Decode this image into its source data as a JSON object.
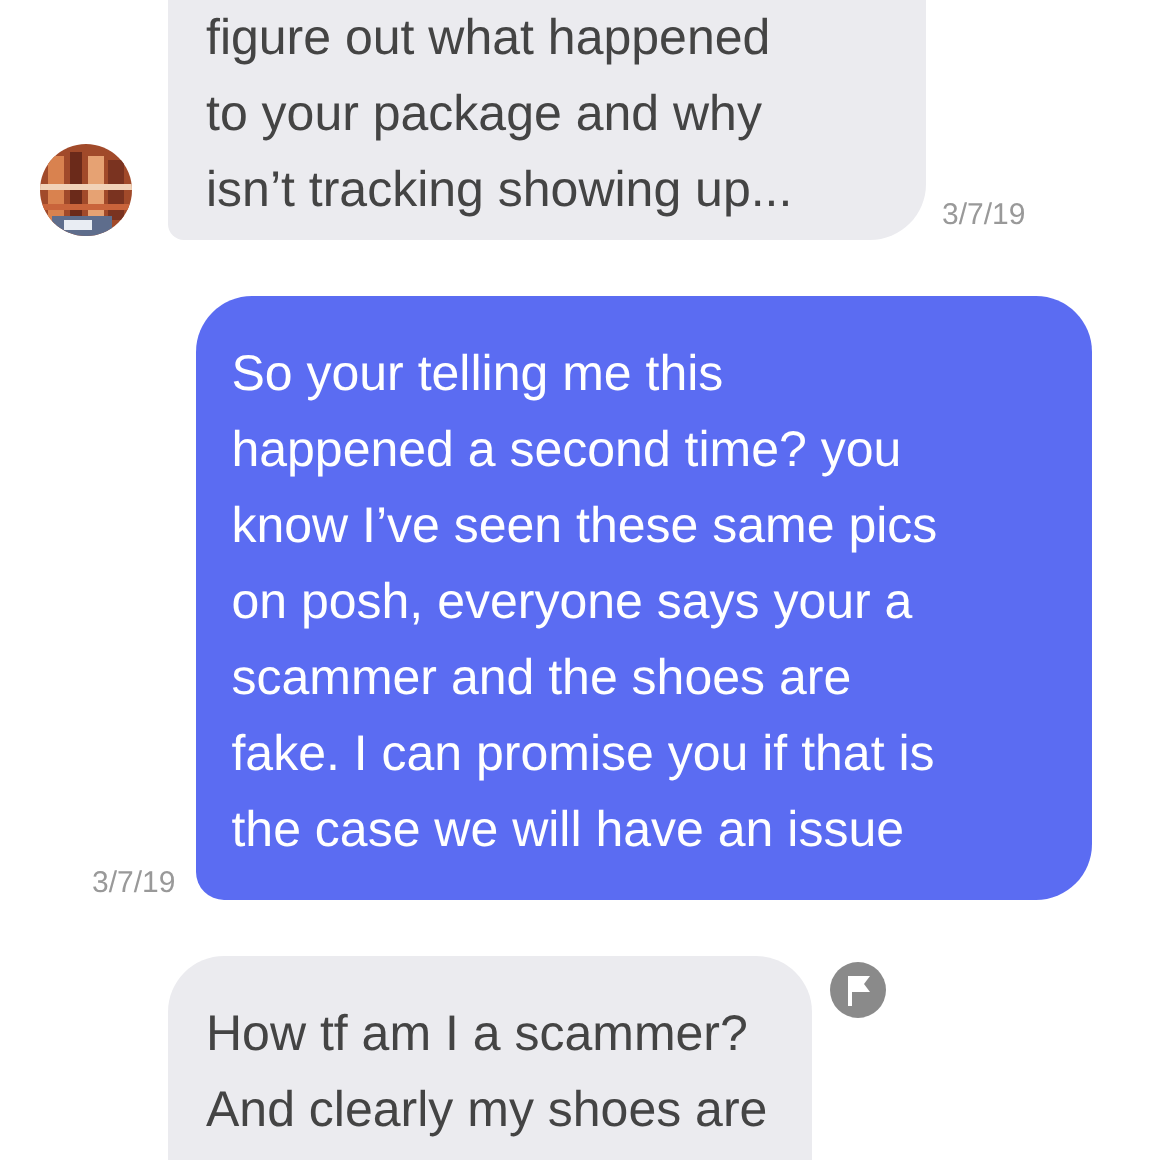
{
  "messages": [
    {
      "kind": "incoming",
      "text": "figure out what happened\nto your package and why\nisn’t tracking showing up...",
      "date": "3/7/19"
    },
    {
      "kind": "outgoing",
      "text": "So your telling me this\nhappened a second time? you\nknow I’ve seen these same pics\non posh, everyone says your a\nscammer and the shoes are\nfake. I can promise you if that is\nthe case we will have an issue",
      "date": "3/7/19"
    },
    {
      "kind": "incoming",
      "text": "How tf am I a scammer?\nAnd clearly my shoes are",
      "flag": true
    }
  ]
}
